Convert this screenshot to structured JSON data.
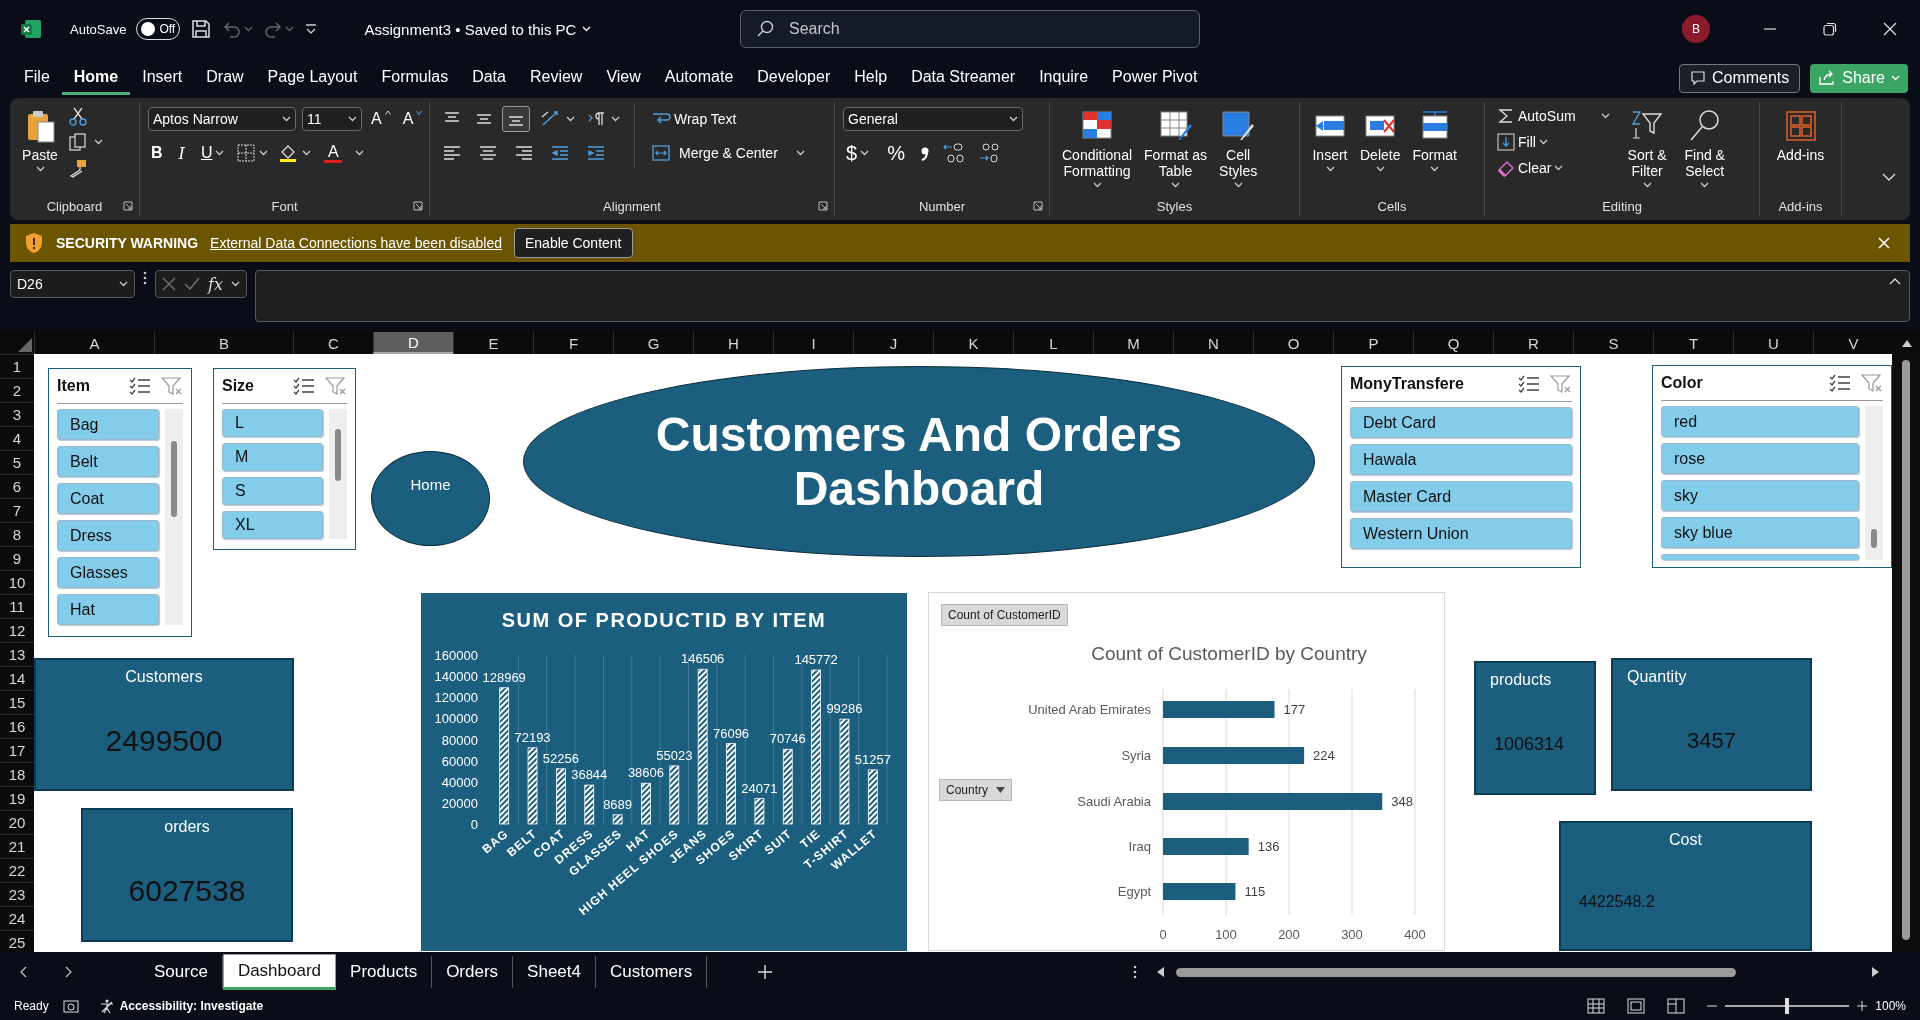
{
  "title_bar": {
    "autosave": {
      "label": "AutoSave",
      "on": false,
      "state": "Off"
    },
    "undo": {
      "disabled": true
    },
    "redo": {
      "disabled": true
    },
    "document": "Assignment3",
    "separator": "•",
    "save_status": "Saved to this PC",
    "search": {
      "placeholder": "Search"
    },
    "avatar": "B"
  },
  "menu_tabs": [
    {
      "label": "File",
      "selected": false
    },
    {
      "label": "Home",
      "selected": true
    },
    {
      "label": "Insert",
      "selected": false
    },
    {
      "label": "Draw",
      "selected": false
    },
    {
      "label": "Page Layout",
      "selected": false
    },
    {
      "label": "Formulas",
      "selected": false
    },
    {
      "label": "Data",
      "selected": false
    },
    {
      "label": "Review",
      "selected": false
    },
    {
      "label": "View",
      "selected": false
    },
    {
      "label": "Automate",
      "selected": false
    },
    {
      "label": "Developer",
      "selected": false
    },
    {
      "label": "Help",
      "selected": false
    },
    {
      "label": "Data Streamer",
      "selected": false
    },
    {
      "label": "Inquire",
      "selected": false
    },
    {
      "label": "Power Pivot",
      "selected": false
    }
  ],
  "header_buttons": {
    "comments": "Comments",
    "share": "Share"
  },
  "ribbon": {
    "clipboard": {
      "paste": "Paste",
      "label": "Clipboard"
    },
    "font": {
      "font_name": "Aptos Narrow",
      "font_size": "11",
      "grow": "A",
      "shrink": "A",
      "bold": "B",
      "italic": "I",
      "underline": "U",
      "font_color": "A",
      "label": "Font"
    },
    "alignment": {
      "vertical": [
        {
          "selected": false
        },
        {
          "selected": false
        },
        {
          "selected": true
        }
      ],
      "wrap_text": "Wrap Text",
      "merge": "Merge & Center",
      "label": "Alignment"
    },
    "number": {
      "format": "General",
      "currency": "$",
      "percent": "%",
      "label": "Number"
    },
    "styles": {
      "buttons": [
        {
          "lines": [
            "Conditional",
            "Formatting"
          ]
        },
        {
          "lines": [
            "Format as",
            "Table"
          ]
        },
        {
          "lines": [
            "Cell",
            "Styles"
          ]
        }
      ],
      "label": "Styles"
    },
    "cells": {
      "buttons": [
        "Insert",
        "Delete",
        "Format"
      ],
      "label": "Cells"
    },
    "editing": {
      "autosum": "AutoSum",
      "fill": "Fill",
      "clear": "Clear",
      "sort": [
        "Sort &",
        "Filter"
      ],
      "find": [
        "Find &",
        "Select"
      ],
      "label": "Editing"
    },
    "addins": {
      "button": "Add-ins",
      "label": "Add-ins"
    }
  },
  "security_bar": {
    "label": "SECURITY WARNING",
    "message": "External Data Connections have been disabled",
    "button": "Enable Content"
  },
  "formula_bar": {
    "name_box": "D26",
    "function_button": "fx"
  },
  "columns": [
    {
      "label": "A",
      "selected": false
    },
    {
      "label": "B",
      "selected": false
    },
    {
      "label": "C",
      "selected": false
    },
    {
      "label": "D",
      "selected": true
    },
    {
      "label": "E",
      "selected": false
    },
    {
      "label": "F",
      "selected": false
    },
    {
      "label": "G",
      "selected": false
    },
    {
      "label": "H",
      "selected": false
    },
    {
      "label": "I",
      "selected": false
    },
    {
      "label": "J",
      "selected": false
    },
    {
      "label": "K",
      "selected": false
    },
    {
      "label": "L",
      "selected": false
    },
    {
      "label": "M",
      "selected": false
    },
    {
      "label": "N",
      "selected": false
    },
    {
      "label": "O",
      "selected": false
    },
    {
      "label": "P",
      "selected": false
    },
    {
      "label": "Q",
      "selected": false
    },
    {
      "label": "R",
      "selected": false
    },
    {
      "label": "S",
      "selected": false
    },
    {
      "label": "T",
      "selected": false
    },
    {
      "label": "U",
      "selected": false
    },
    {
      "label": "V",
      "selected": false
    }
  ],
  "rows": [
    "1",
    "2",
    "3",
    "4",
    "5",
    "6",
    "7",
    "8",
    "9",
    "10",
    "11",
    "12",
    "13",
    "14",
    "15",
    "16",
    "17",
    "18",
    "19",
    "20",
    "21",
    "22",
    "23",
    "24",
    "25"
  ],
  "dashboard": {
    "slicers": [
      {
        "title": "Item",
        "items": [
          {
            "label": "Bag",
            "selected": true
          },
          {
            "label": "Belt",
            "selected": true
          },
          {
            "label": "Coat",
            "selected": true
          },
          {
            "label": "Dress",
            "selected": true
          },
          {
            "label": "Glasses",
            "selected": true
          },
          {
            "label": "Hat",
            "selected": true
          }
        ]
      },
      {
        "title": "Size",
        "items": [
          {
            "label": "L",
            "selected": true
          },
          {
            "label": "M",
            "selected": true
          },
          {
            "label": "S",
            "selected": true
          },
          {
            "label": "XL",
            "selected": true
          }
        ]
      },
      {
        "title": "MonyTransfere",
        "items": [
          {
            "label": "Debt Card",
            "selected": true
          },
          {
            "label": "Hawala",
            "selected": true
          },
          {
            "label": "Master Card",
            "selected": true
          },
          {
            "label": "Western Union",
            "selected": true
          }
        ]
      },
      {
        "title": "Color",
        "more_below": true,
        "items": [
          {
            "label": "red",
            "selected": true
          },
          {
            "label": "rose",
            "selected": true
          },
          {
            "label": "sky",
            "selected": true
          },
          {
            "label": "sky blue",
            "selected": true
          }
        ]
      }
    ],
    "title": "Customers And Orders Dashboard",
    "home_button": "Home",
    "kpis": [
      {
        "label": "Customers",
        "value": "2499500"
      },
      {
        "label": "orders",
        "value": "6027538"
      },
      {
        "label": "products",
        "value": "1006314"
      },
      {
        "label": "Quantity",
        "value": "3457"
      },
      {
        "label": "Cost",
        "value": "4422548.2"
      }
    ],
    "item_chart": {
      "chart_data": {
        "type": "bar",
        "title": "SUM OF PRODUCTID BY ITEM",
        "categories": [
          "BAG",
          "BELT",
          "COAT",
          "DRESS",
          "GLASSES",
          "HAT",
          "HIGH HEEL SHOES",
          "JEANS",
          "SHOES",
          "SKIRT",
          "SUIT",
          "TIE",
          "T-SHIRT",
          "WALLET"
        ],
        "values": [
          128969,
          72193,
          52256,
          36844,
          8689,
          38606,
          55023,
          146506,
          76096,
          24071,
          70746,
          145772,
          99286,
          51257
        ],
        "ylim": [
          0,
          160000
        ],
        "yticks": [
          0,
          20000,
          40000,
          60000,
          80000,
          100000,
          120000,
          140000,
          160000
        ],
        "grid": true,
        "data_labels": true
      }
    },
    "country_chart": {
      "value_field_button": "Count of CustomerID",
      "axis_field_button": "Country",
      "chart_data": {
        "type": "bar",
        "orientation": "horizontal",
        "title": "Count of CustomerID by Country",
        "categories": [
          "United Arab Emirates",
          "Syria",
          "Saudi Arabia",
          "Iraq",
          "Egypt"
        ],
        "values": [
          177,
          224,
          348,
          136,
          115
        ],
        "xlim": [
          0,
          400
        ],
        "xticks": [
          0,
          100,
          200,
          300,
          400
        ],
        "grid": true,
        "data_labels": true
      }
    }
  },
  "sheet_tabs": [
    {
      "label": "Source",
      "selected": false
    },
    {
      "label": "Dashboard",
      "selected": true
    },
    {
      "label": "Products",
      "selected": false
    },
    {
      "label": "Orders",
      "selected": false
    },
    {
      "label": "Sheet4",
      "selected": false
    },
    {
      "label": "Customers",
      "selected": false
    }
  ],
  "status_bar": {
    "ready": "Ready",
    "accessibility": "Accessibility: Investigate",
    "zoom": {
      "level": 0.5,
      "reading": "100%"
    }
  }
}
